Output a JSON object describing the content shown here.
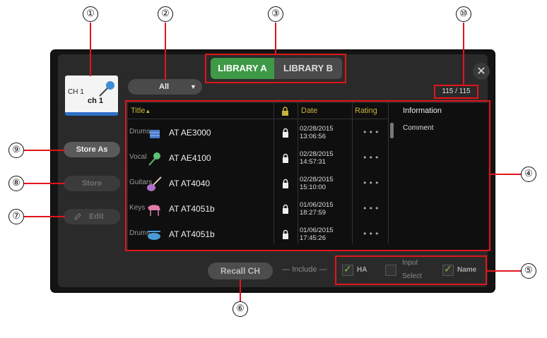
{
  "callouts": [
    "①",
    "②",
    "③",
    "④",
    "⑤",
    "⑥",
    "⑦",
    "⑧",
    "⑨",
    "⑩"
  ],
  "colors": {
    "accent_green": "#3e9a47",
    "annotation_red": "#e2141c",
    "channel_blue": "#2d6fc9",
    "date_header_yellow": "#c8b43c"
  },
  "channel": {
    "label": "CH 1",
    "name": "ch 1",
    "icon": "microphone-icon"
  },
  "close_icon": "✕",
  "filter": {
    "selected": "All",
    "arrow": "▼"
  },
  "library_tabs": [
    "LIBRARY A",
    "LIBRARY B"
  ],
  "count": "115 / 115",
  "side_buttons": {
    "store_as": "Store As",
    "store": "Store",
    "edit": "Edit"
  },
  "table": {
    "headers": {
      "title": "Title",
      "sort_arrow": "▲",
      "date": "Date",
      "rating": "Rating",
      "information": "Information"
    },
    "comment_label": "Comment",
    "rows": [
      {
        "category": "Drums",
        "icon": "drum-icon",
        "title": "AT AE3000",
        "date": "02/28/2015",
        "time": "13:06:56",
        "rating": "•••"
      },
      {
        "category": "Vocal",
        "icon": "microphone-icon",
        "title": "AT AE4100",
        "date": "02/28/2015",
        "time": "14:57:31",
        "rating": "•••"
      },
      {
        "category": "Guitars",
        "icon": "guitar-icon",
        "title": "AT AT4040",
        "date": "02/28/2015",
        "time": "15:10:00",
        "rating": "•••"
      },
      {
        "category": "Keys",
        "icon": "piano-icon",
        "title": "AT AT4051b",
        "date": "01/06/2015",
        "time": "18:27:59",
        "rating": "•••"
      },
      {
        "category": "Drums",
        "icon": "drum-icon",
        "title": "AT AT4051b",
        "date": "01/06/2015",
        "time": "17:45:26",
        "rating": "•••"
      }
    ]
  },
  "bottom": {
    "recall": "Recall CH",
    "include": "Include",
    "ha": "HA",
    "input_select_1": "Input",
    "input_select_2": "Select",
    "name": "Name",
    "check": "✓"
  }
}
